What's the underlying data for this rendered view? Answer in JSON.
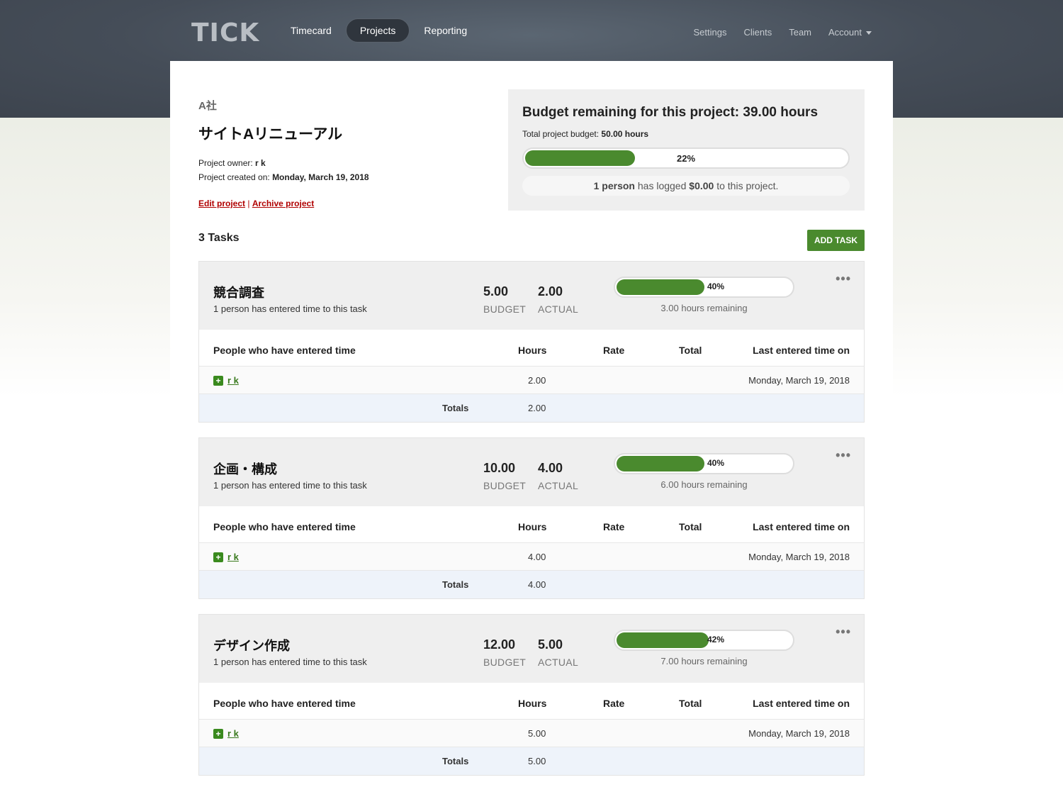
{
  "nav": {
    "logo": "TICK",
    "main": [
      "Timecard",
      "Projects",
      "Reporting"
    ],
    "active": "Projects",
    "secondary": [
      "Settings",
      "Clients",
      "Team",
      "Account"
    ]
  },
  "project": {
    "client": "A社",
    "title": "サイトAリニューアル",
    "owner_label": "Project owner: ",
    "owner": "r k",
    "created_label": "Project created on: ",
    "created": "Monday, March 19, 2018",
    "edit_label": "Edit project",
    "separator": "|",
    "archive_label": "Archive project"
  },
  "budget": {
    "title": "Budget remaining for this project: 39.00 hours",
    "total_label": "Total project budget: ",
    "total_value": "50.00 hours",
    "percent_label": "22%",
    "percent": 22,
    "logged_people": "1 person",
    "logged_mid": " has logged ",
    "logged_amount": "$0.00",
    "logged_end": " to this project."
  },
  "tasks_header": {
    "title": "3 Tasks",
    "add_button": "ADD TASK"
  },
  "table_headers": {
    "people": "People who have entered time",
    "hours": "Hours",
    "rate": "Rate",
    "total": "Total",
    "last": "Last entered time on",
    "totals": "Totals"
  },
  "labels": {
    "budget": "BUDGET",
    "actual": "ACTUAL",
    "plus": "+",
    "more": "•••"
  },
  "tasks": [
    {
      "name": "競合調査",
      "sub": "1 person has entered time to this task",
      "budget": "5.00",
      "actual": "2.00",
      "percent_label": "40%",
      "percent": 40,
      "remaining": "3.00 hours remaining",
      "person": "r k",
      "hours": "2.00",
      "last": "Monday, March 19, 2018",
      "totals_hours": "2.00"
    },
    {
      "name": "企画・構成",
      "sub": "1 person has entered time to this task",
      "budget": "10.00",
      "actual": "4.00",
      "percent_label": "40%",
      "percent": 40,
      "remaining": "6.00 hours remaining",
      "person": "r k",
      "hours": "4.00",
      "last": "Monday, March 19, 2018",
      "totals_hours": "4.00"
    },
    {
      "name": "デザイン作成",
      "sub": "1 person has entered time to this task",
      "budget": "12.00",
      "actual": "5.00",
      "percent_label": "42%",
      "percent": 42,
      "remaining": "7.00 hours remaining",
      "person": "r k",
      "hours": "5.00",
      "last": "Monday, March 19, 2018",
      "totals_hours": "5.00"
    }
  ]
}
